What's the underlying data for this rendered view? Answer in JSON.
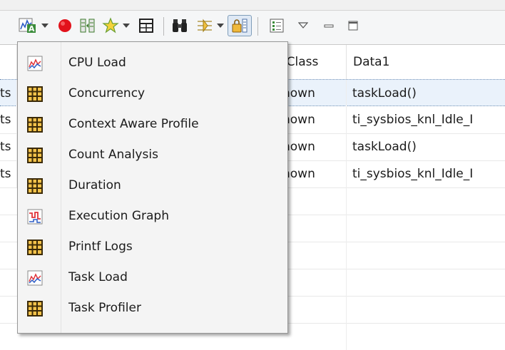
{
  "toolbar": {
    "icons": [
      "analysis-icon",
      "dropdown-arrow-icon",
      "record-icon",
      "columns-icon",
      "star-icon",
      "dropdown-arrow-icon",
      "table-view-icon",
      "binoculars-icon",
      "filter-icon",
      "dropdown-arrow-icon",
      "lock-scroll-icon",
      "legend-icon",
      "view-menu-icon",
      "minimize-icon",
      "maximize-icon"
    ]
  },
  "table": {
    "columns": [
      "",
      "",
      "tClass",
      "Data1"
    ],
    "rows": [
      {
        "c1": "ts",
        "c2": "",
        "c3": "nown",
        "c4": "taskLoad()"
      },
      {
        "c1": "ts",
        "c2": "",
        "c3": "nown",
        "c4": "ti_sysbios_knl_Idle_I"
      },
      {
        "c1": "ts",
        "c2": "",
        "c3": "nown",
        "c4": "taskLoad()"
      },
      {
        "c1": "ts",
        "c2": "",
        "c3": "nown",
        "c4": "ti_sysbios_knl_Idle_I"
      }
    ]
  },
  "menu": {
    "items": [
      {
        "label": "CPU Load",
        "icon": "line-graph-icon"
      },
      {
        "label": "Concurrency",
        "icon": "table-grid-icon"
      },
      {
        "label": "Context Aware Profile",
        "icon": "table-grid-icon"
      },
      {
        "label": "Count Analysis",
        "icon": "table-grid-icon"
      },
      {
        "label": "Duration",
        "icon": "table-grid-icon"
      },
      {
        "label": "Execution Graph",
        "icon": "execution-graph-icon"
      },
      {
        "label": "Printf Logs",
        "icon": "table-grid-icon"
      },
      {
        "label": "Task Load",
        "icon": "line-graph-icon"
      },
      {
        "label": "Task Profiler",
        "icon": "table-grid-icon"
      }
    ]
  },
  "colors": {
    "accent": "#7f9db9",
    "record_red": "#e2121b",
    "grid_icon_dark": "#6b4a12",
    "grid_icon_fill": "#f3c24a",
    "graph_line_red": "#e0333a",
    "graph_line_blue": "#2b5cc6"
  }
}
